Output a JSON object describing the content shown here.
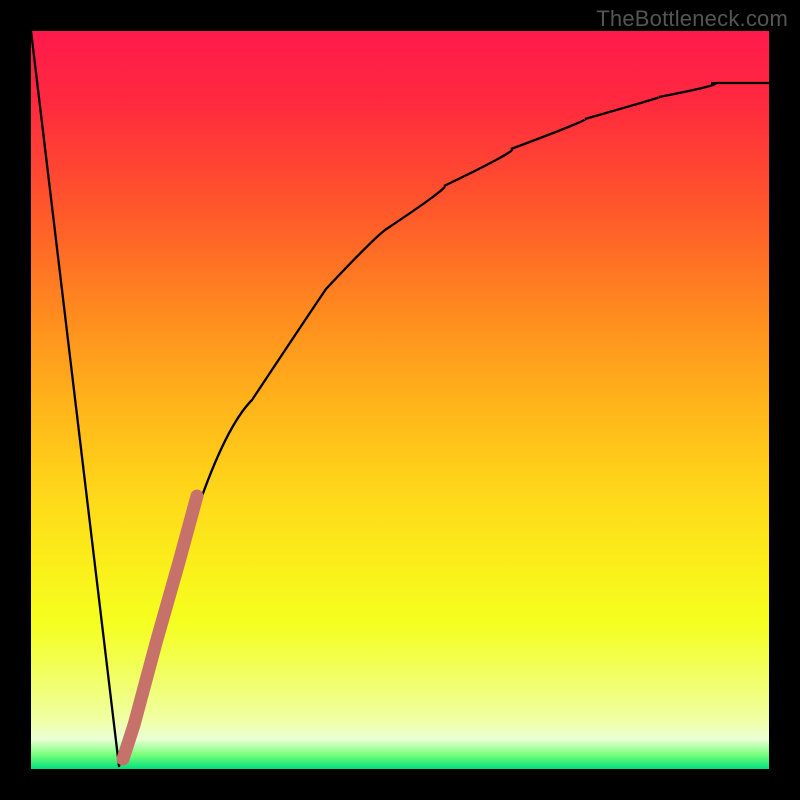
{
  "watermark": "TheBottleneck.com",
  "colors": {
    "curve_main": "#000000",
    "highlight_segment": "#c6726a",
    "frame": "#000000"
  },
  "chart_data": {
    "type": "line",
    "title": "",
    "xlabel": "",
    "ylabel": "",
    "xlim": [
      0,
      100
    ],
    "ylim": [
      0,
      100
    ],
    "grid": false,
    "series": [
      {
        "name": "left_descent",
        "x": [
          0,
          12
        ],
        "values": [
          100,
          0
        ]
      },
      {
        "name": "right_curve",
        "x": [
          12,
          15,
          18,
          21,
          25,
          30,
          35,
          40,
          48,
          56,
          65,
          75,
          85,
          92,
          100
        ],
        "values": [
          0,
          10,
          20,
          30,
          40,
          50,
          58,
          65,
          73,
          79,
          84,
          88,
          91,
          92,
          93
        ]
      },
      {
        "name": "highlight_segment",
        "x": [
          12.5,
          14,
          17,
          20,
          22.5
        ],
        "values": [
          1,
          6,
          17,
          28,
          37
        ]
      }
    ]
  }
}
